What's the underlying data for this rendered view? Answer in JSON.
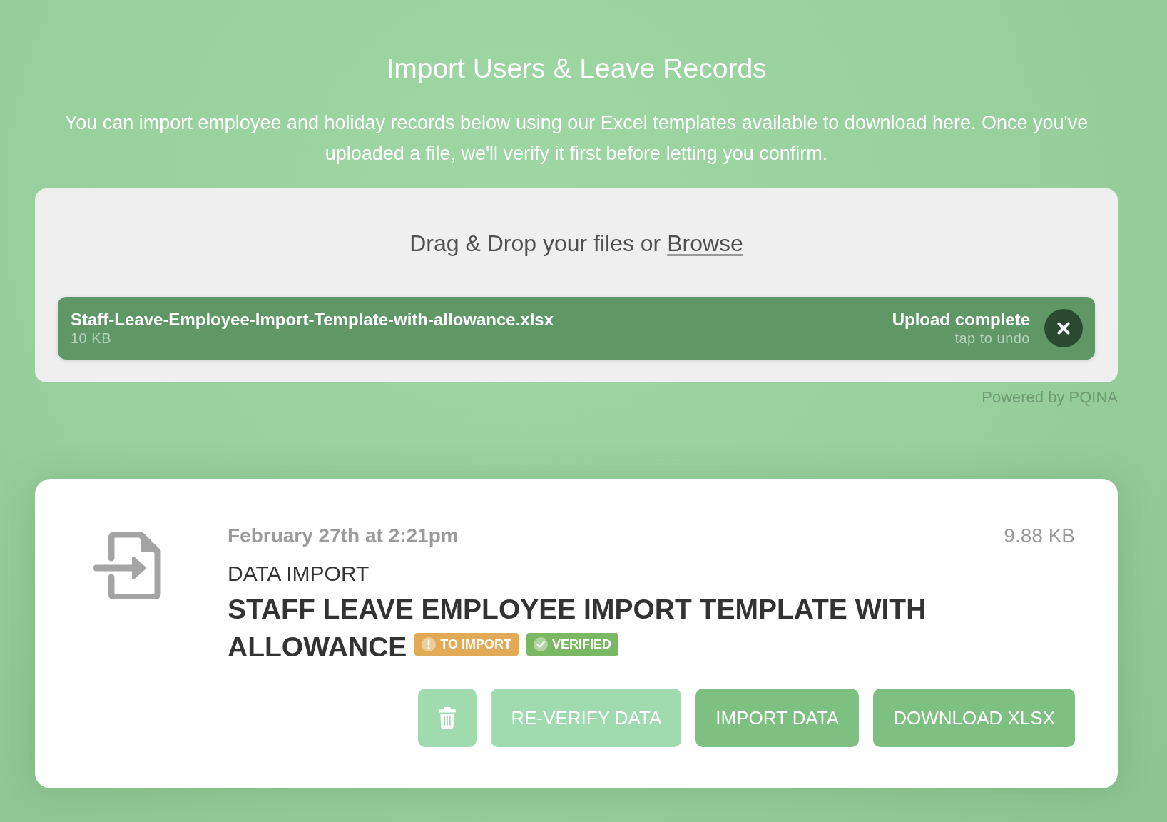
{
  "header": {
    "title": "Import Users & Leave Records",
    "description": "You can import employee and holiday records below using our Excel templates available to download here. Once you've uploaded a file, we'll verify it first before letting you confirm."
  },
  "dropzone": {
    "prompt": "Drag & Drop your files or",
    "link": "Browse",
    "files": [
      {
        "name": "Staff-Leave-Employee-Import-Template-with-allowance.xlsx",
        "size": "10 KB",
        "status": "Upload complete",
        "hint": "tap to undo"
      }
    ],
    "credit": "Powered by PQINA"
  },
  "import_card": {
    "date": "February 27th at 2:21pm",
    "file_size": "9.88 KB",
    "category": "DATA IMPORT",
    "title_lines": [
      "STAFF LEAVE EMPLOYEE IMPORT TEMPLATE WITH",
      "ALLOWANCE"
    ],
    "badges": [
      {
        "kind": "warning",
        "label": "TO IMPORT"
      },
      {
        "kind": "success",
        "label": "VERIFIED"
      }
    ],
    "actions": [
      {
        "kind": "delete"
      },
      {
        "kind": "secondary",
        "label": "RE-VERIFY DATA"
      },
      {
        "kind": "primary",
        "label": "IMPORT DATA"
      },
      {
        "kind": "primary",
        "label": "DOWNLOAD XLSX"
      }
    ]
  }
}
